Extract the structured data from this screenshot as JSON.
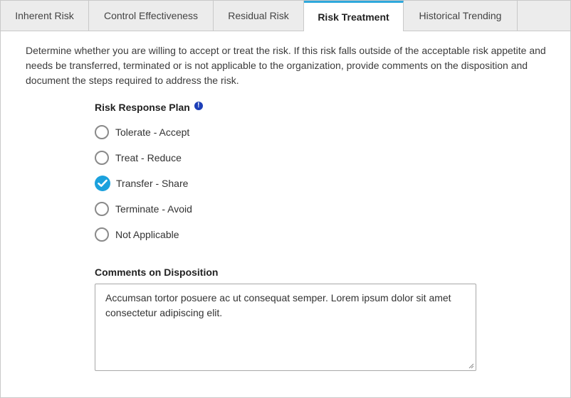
{
  "tabs": [
    {
      "label": "Inherent Risk",
      "active": false
    },
    {
      "label": "Control Effectiveness",
      "active": false
    },
    {
      "label": "Residual Risk",
      "active": false
    },
    {
      "label": "Risk Treatment",
      "active": true
    },
    {
      "label": "Historical Trending",
      "active": false
    }
  ],
  "description": "Determine whether you are willing to accept or treat the risk. If this risk falls outside of the acceptable risk appetite and needs be transferred, terminated or is not applicable to the organization, provide comments on the disposition and document the steps required to address the risk.",
  "risk_response_plan": {
    "label": "Risk Response Plan",
    "info_icon": "exclamation-info-icon",
    "options": [
      {
        "label": "Tolerate - Accept",
        "checked": false
      },
      {
        "label": "Treat - Reduce",
        "checked": false
      },
      {
        "label": "Transfer - Share",
        "checked": true
      },
      {
        "label": "Terminate - Avoid",
        "checked": false
      },
      {
        "label": "Not Applicable",
        "checked": false
      }
    ]
  },
  "comments": {
    "label": "Comments on Disposition",
    "value": "Accumsan tortor posuere ac ut consequat semper. Lorem ipsum dolor sit amet consectetur adipiscing elit."
  },
  "colors": {
    "accent": "#1ba1dd",
    "tab_active_border": "#2ea8dc",
    "info_icon": "#1d3fb8"
  }
}
